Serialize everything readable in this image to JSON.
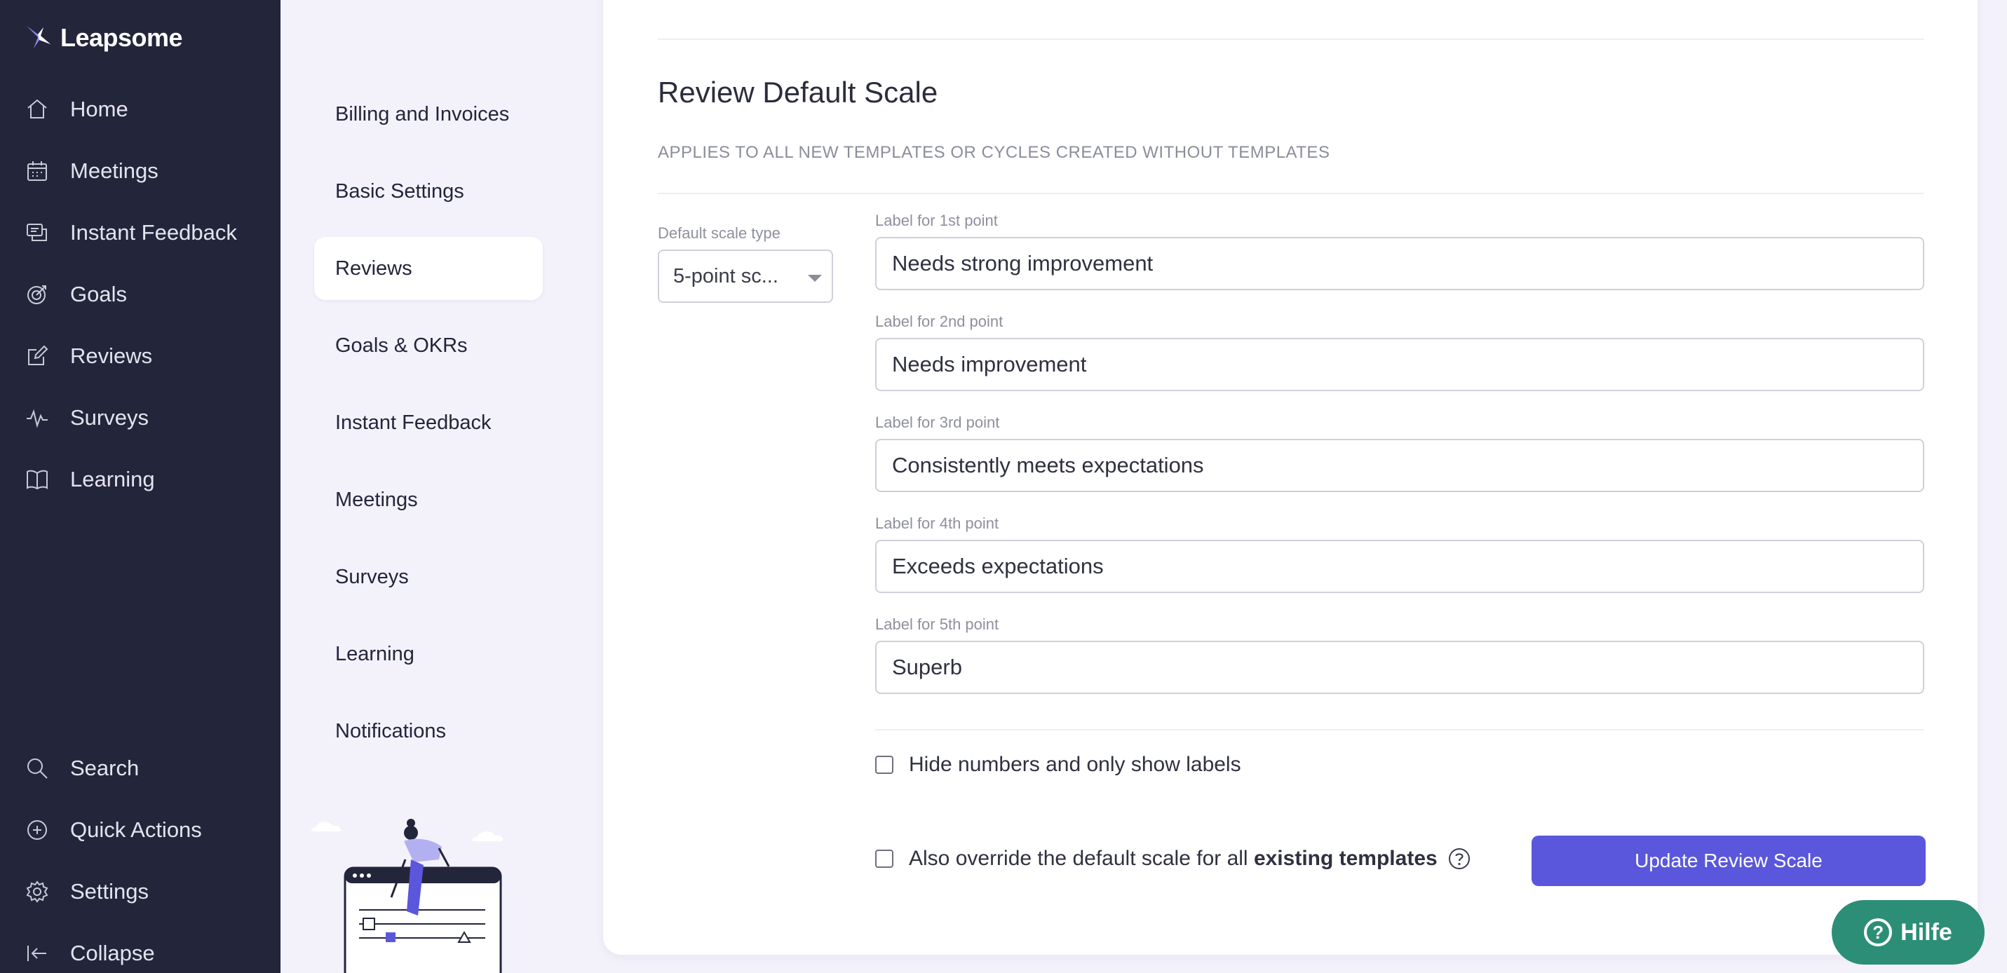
{
  "brand": {
    "name": "Leapsome"
  },
  "nav": {
    "items": [
      {
        "label": "Home",
        "icon": "home-icon"
      },
      {
        "label": "Meetings",
        "icon": "calendar-icon"
      },
      {
        "label": "Instant Feedback",
        "icon": "chat-icon"
      },
      {
        "label": "Goals",
        "icon": "target-icon"
      },
      {
        "label": "Reviews",
        "icon": "edit-icon"
      },
      {
        "label": "Surveys",
        "icon": "pulse-icon"
      },
      {
        "label": "Learning",
        "icon": "book-icon"
      }
    ],
    "bottom": [
      {
        "label": "Search",
        "icon": "search-icon"
      },
      {
        "label": "Quick Actions",
        "icon": "plus-circle-icon"
      },
      {
        "label": "Settings",
        "icon": "gear-icon"
      },
      {
        "label": "Collapse",
        "icon": "collapse-icon"
      }
    ]
  },
  "settings_menu": {
    "items": [
      {
        "label": "Billing and Invoices"
      },
      {
        "label": "Basic Settings"
      },
      {
        "label": "Reviews",
        "active": true
      },
      {
        "label": "Goals & OKRs"
      },
      {
        "label": "Instant Feedback"
      },
      {
        "label": "Meetings"
      },
      {
        "label": "Surveys"
      },
      {
        "label": "Learning"
      },
      {
        "label": "Notifications"
      }
    ]
  },
  "review_scale": {
    "title": "Review Default Scale",
    "subtitle": "APPLIES TO ALL NEW TEMPLATES OR CYCLES CREATED WITHOUT TEMPLATES",
    "scale_type_label": "Default scale type",
    "scale_type_value": "5-point sc...",
    "points": [
      {
        "label": "Label for 1st point",
        "value": "Needs strong improvement"
      },
      {
        "label": "Label for 2nd point",
        "value": "Needs improvement"
      },
      {
        "label": "Label for 3rd point",
        "value": "Consistently meets expectations"
      },
      {
        "label": "Label for 4th point",
        "value": "Exceeds expectations"
      },
      {
        "label": "Label for 5th point",
        "value": "Superb"
      }
    ],
    "hide_numbers_label": "Hide numbers and only show labels",
    "override_label_prefix": "Also override the default scale for all",
    "override_label_bold": "existing templates",
    "update_button": "Update Review Scale"
  },
  "help": {
    "label": "Hilfe"
  },
  "colors": {
    "nav_bg": "#23253b",
    "primary": "#5a57dc",
    "help": "#2c8e76"
  }
}
